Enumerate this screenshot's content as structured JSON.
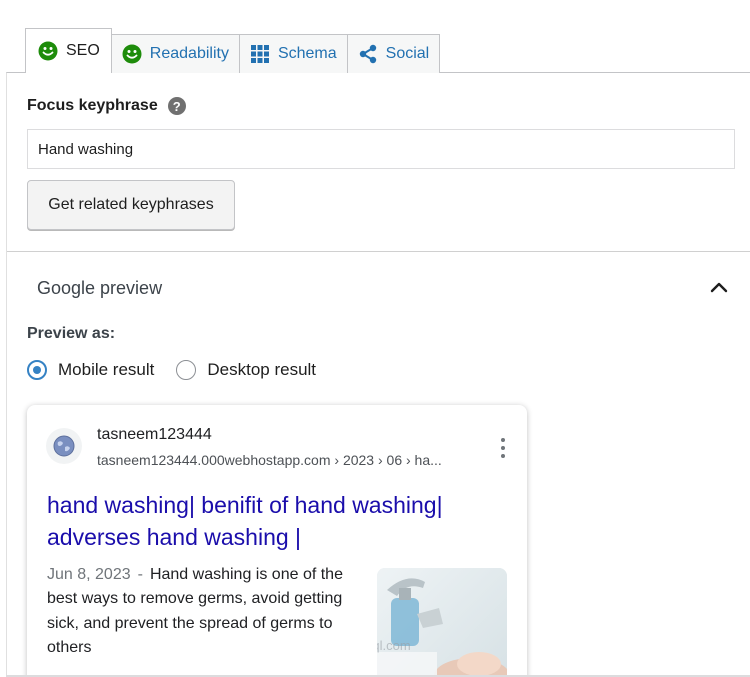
{
  "tabs": [
    {
      "label": "SEO",
      "icon": "smiley-icon",
      "active": true
    },
    {
      "label": "Readability",
      "icon": "smiley-icon",
      "active": false
    },
    {
      "label": "Schema",
      "icon": "grid-icon",
      "active": false
    },
    {
      "label": "Social",
      "icon": "share-icon",
      "active": false
    }
  ],
  "focus": {
    "label": "Focus keyphrase",
    "help": "?",
    "value": "Hand washing",
    "related_button": "Get related keyphrases"
  },
  "google_preview": {
    "title": "Google preview",
    "preview_as": "Preview as:",
    "options": [
      {
        "label": "Mobile result",
        "selected": true
      },
      {
        "label": "Desktop result",
        "selected": false
      }
    ],
    "card": {
      "site_name": "tasneem123444",
      "url": "tasneem123444.000webhostapp.com › 2023 › 06 › ha...",
      "title": "hand washing| benifit of hand washing| adverses hand washing |",
      "date": "Jun 8, 2023",
      "separator": "-",
      "snippet": "Hand washing is one of the best ways to remove germs, avoid getting sick, and prevent the spread of germs to others",
      "watermark": "mostaql.com"
    }
  },
  "colors": {
    "tab_link": "#2271b1",
    "smiley_green": "#1e8c0b",
    "google_title": "#1a0dab",
    "radio_accent": "#3582c4"
  }
}
